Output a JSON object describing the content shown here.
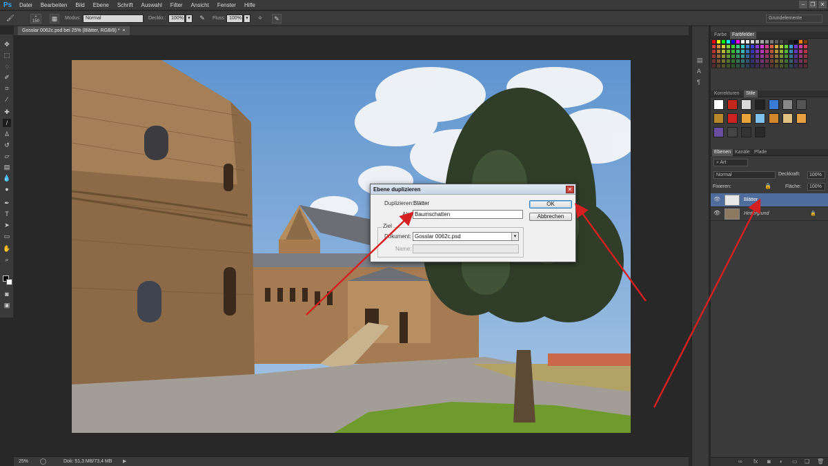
{
  "app": {
    "logo": "Ps"
  },
  "menu": [
    "Datei",
    "Bearbeiten",
    "Bild",
    "Ebene",
    "Schrift",
    "Auswahl",
    "Filter",
    "Ansicht",
    "Fenster",
    "Hilfe"
  ],
  "options": {
    "brush_size": "150",
    "modus_label": "Modus:",
    "modus_value": "Normal",
    "deckkr_label": "Deckkr.:",
    "deckkr_value": "100%",
    "fluss_label": "Fluss:",
    "fluss_value": "100%",
    "workspace": "Grundelemente"
  },
  "document": {
    "tab_title": "Gosslar 0062c.psd bei 25% (Blätter, RGB/8) *"
  },
  "status": {
    "zoom": "25%",
    "doc_info": "Dok: 51,3 MB/73,4 MB"
  },
  "panels": {
    "color_tabs": [
      "Farbe",
      "Farbfelder"
    ],
    "style_tabs": [
      "Korrekturen",
      "Stile"
    ],
    "layer_tabs": [
      "Ebenen",
      "Kanäle",
      "Pfade"
    ],
    "layer_filter": "Art",
    "blend_mode": "Normal",
    "opacity_label": "Deckkraft:",
    "opacity_value": "100%",
    "lock_label": "Fixieren:",
    "fill_label": "Fläche:",
    "fill_value": "100%",
    "layers": [
      {
        "name": "Blätter",
        "selected": true
      },
      {
        "name": "Hintergrund",
        "selected": false
      }
    ]
  },
  "dialog": {
    "title": "Ebene duplizieren",
    "duplicate_label": "Duplizieren:",
    "duplicate_value": "Blätter",
    "as_label": "Als:",
    "as_value": "Baumschatten",
    "group_label": "Ziel",
    "document_label": "Dokument:",
    "document_value": "Gosslar 0062c.psd",
    "name_label": "Name:",
    "ok_label": "OK",
    "cancel_label": "Abbrechen"
  },
  "icons": [
    "brush-icon",
    "move-icon",
    "marquee-icon",
    "lasso-icon",
    "crop-icon",
    "eyedropper-icon",
    "healing-icon",
    "stamp-icon",
    "eraser-icon",
    "gradient-icon",
    "pen-icon",
    "type-icon",
    "hand-icon",
    "zoom-icon",
    "eye-icon",
    "lock-icon",
    "close-icon",
    "dropdown-arrow-icon"
  ],
  "colors": {
    "accent": "#4e6d9c",
    "arrow": "#d42020",
    "ps_blue": "#31a8ff"
  }
}
